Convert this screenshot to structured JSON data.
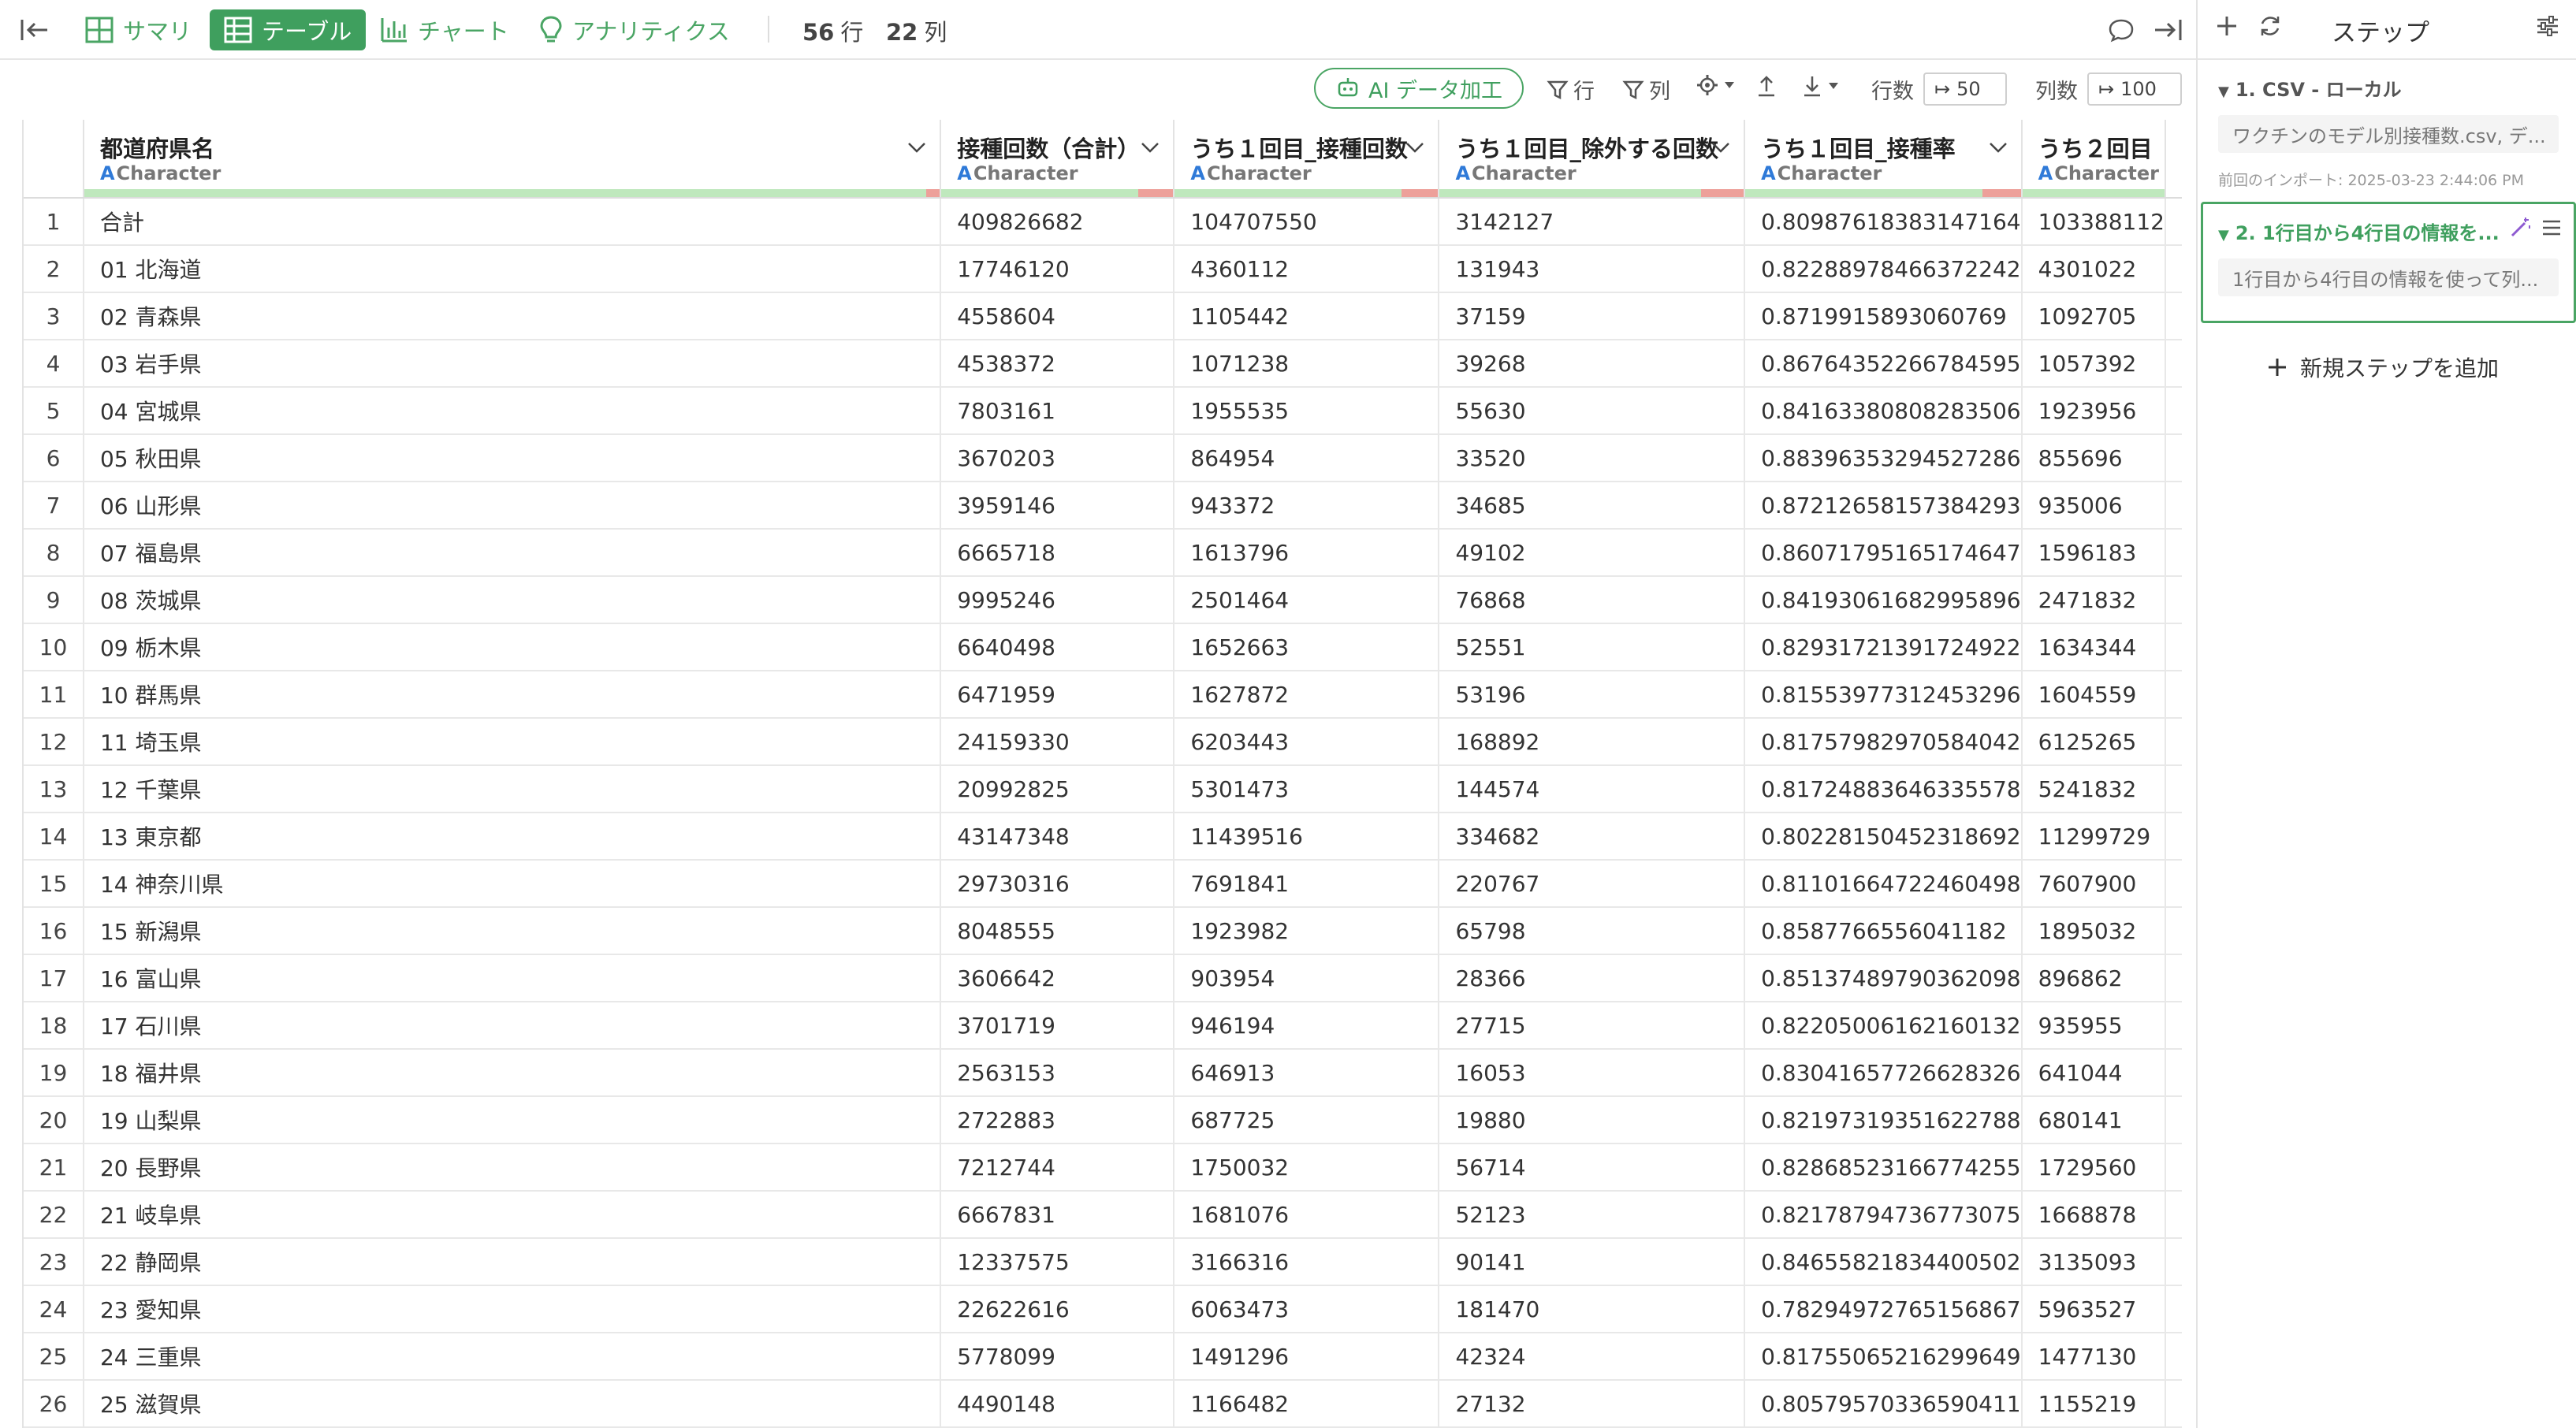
{
  "toolbar": {
    "tabs": [
      {
        "label": "サマリ"
      },
      {
        "label": "テーブル"
      },
      {
        "label": "チャート"
      },
      {
        "label": "アナリティクス"
      }
    ],
    "row_count": "56",
    "row_unit": "行",
    "col_count": "22",
    "col_unit": "列"
  },
  "subtoolbar": {
    "ai_label": "AI データ加工",
    "filter_row_label": "行",
    "filter_col_label": "列",
    "rows_label": "行数",
    "rows_value": "50",
    "cols_label": "列数",
    "cols_value": "100"
  },
  "columns": [
    {
      "name": "都道府県名",
      "type": "Character",
      "red": 0.016
    },
    {
      "name": "接種回数（合計）",
      "type": "Character",
      "red": 0.15
    },
    {
      "name": "うち１回目_接種回数",
      "type": "Character",
      "red": 0.14
    },
    {
      "name": "うち１回目_除外する回数",
      "type": "Character",
      "red": 0.14
    },
    {
      "name": "うち１回目_接種率",
      "type": "Character",
      "red": 0.14
    },
    {
      "name": "うち２回目",
      "type": "Character",
      "red": 0.0
    }
  ],
  "rows": [
    [
      "1",
      "合計",
      "409826682",
      "104707550",
      "3142127",
      "0.80987618383147164",
      "103388112"
    ],
    [
      "2",
      "01 北海道",
      "17746120",
      "4360112",
      "131943",
      "0.82288978466372242",
      "4301022"
    ],
    [
      "3",
      "02 青森県",
      "4558604",
      "1105442",
      "37159",
      "0.8719915893060769",
      "1092705"
    ],
    [
      "4",
      "03 岩手県",
      "4538372",
      "1071238",
      "39268",
      "0.86764352266784595",
      "1057392"
    ],
    [
      "5",
      "04 宮城県",
      "7803161",
      "1955535",
      "55630",
      "0.84163380808283506",
      "1923956"
    ],
    [
      "6",
      "05 秋田県",
      "3670203",
      "864954",
      "33520",
      "0.88396353294527286",
      "855696"
    ],
    [
      "7",
      "06 山形県",
      "3959146",
      "943372",
      "34685",
      "0.87212658157384293",
      "935006"
    ],
    [
      "8",
      "07 福島県",
      "6665718",
      "1613796",
      "49102",
      "0.86071795165174647",
      "1596183"
    ],
    [
      "9",
      "08 茨城県",
      "9995246",
      "2501464",
      "76868",
      "0.84193061682995896",
      "2471832"
    ],
    [
      "10",
      "09 栃木県",
      "6640498",
      "1652663",
      "52551",
      "0.82931721391724922",
      "1634344"
    ],
    [
      "11",
      "10 群馬県",
      "6471959",
      "1627872",
      "53196",
      "0.81553977312453296",
      "1604559"
    ],
    [
      "12",
      "11 埼玉県",
      "24159330",
      "6203443",
      "168892",
      "0.81757982970584042",
      "6125265"
    ],
    [
      "13",
      "12 千葉県",
      "20992825",
      "5301473",
      "144574",
      "0.81724883646335578",
      "5241832"
    ],
    [
      "14",
      "13 東京都",
      "43147348",
      "11439516",
      "334682",
      "0.80228150452318692",
      "11299729"
    ],
    [
      "15",
      "14 神奈川県",
      "29730316",
      "7691841",
      "220767",
      "0.81101664722460498",
      "7607900"
    ],
    [
      "16",
      "15 新潟県",
      "8048555",
      "1923982",
      "65798",
      "0.8587766556041182",
      "1895032"
    ],
    [
      "17",
      "16 富山県",
      "3606642",
      "903954",
      "28366",
      "0.85137489790362098",
      "896862"
    ],
    [
      "18",
      "17 石川県",
      "3701719",
      "946194",
      "27715",
      "0.82205006162160132",
      "935955"
    ],
    [
      "19",
      "18 福井県",
      "2563153",
      "646913",
      "16053",
      "0.83041657726628326",
      "641044"
    ],
    [
      "20",
      "19 山梨県",
      "2722883",
      "687725",
      "19880",
      "0.82197319351622788",
      "680141"
    ],
    [
      "21",
      "20 長野県",
      "7212744",
      "1750032",
      "56714",
      "0.82868523166774255",
      "1729560"
    ],
    [
      "22",
      "21 岐阜県",
      "6667831",
      "1681076",
      "52123",
      "0.82178794736773075",
      "1668878"
    ],
    [
      "23",
      "22 静岡県",
      "12337575",
      "3166316",
      "90141",
      "0.84655821834400502",
      "3135093"
    ],
    [
      "24",
      "23 愛知県",
      "22622616",
      "6063473",
      "181470",
      "0.78294972765156867",
      "5963527"
    ],
    [
      "25",
      "24 三重県",
      "5778099",
      "1491296",
      "42324",
      "0.81755065216299649",
      "1477130"
    ],
    [
      "26",
      "25 滋賀県",
      "4490148",
      "1166482",
      "27132",
      "0.80579570336590411",
      "1155219"
    ]
  ],
  "panel": {
    "title": "ステップ",
    "step1_title": "1. CSV - ローカル",
    "step1_detail": "ワクチンのモデル別接種数.csv, デ...",
    "step1_meta": "前回のインポート: 2025-03-23 2:44:06 PM",
    "step2_title": "2. 1行目から4行目の情報を...",
    "step2_detail": "1行目から4行目の情報を使って列...",
    "add_step": "新規ステップを追加"
  },
  "colors": {
    "accent": "#3f9f5e",
    "type_blue": "#2f7ad8",
    "bar_green": "#bfe8bd",
    "bar_red": "#eda09a",
    "wand_purple": "#8e5bd1"
  }
}
